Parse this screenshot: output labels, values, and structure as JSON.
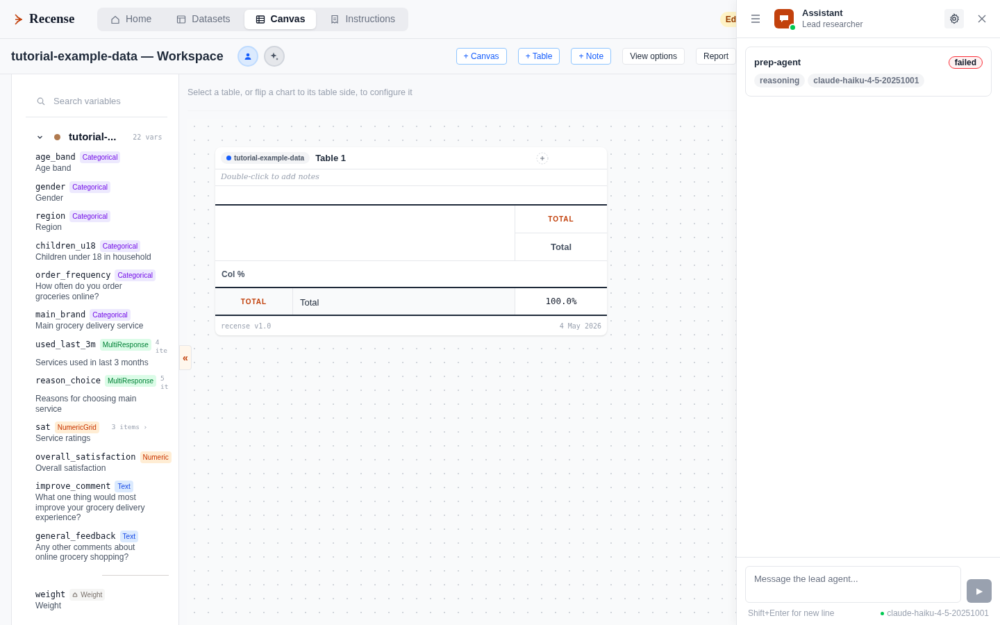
{
  "brand": "Recense",
  "nav_tabs": [
    {
      "label": "Home",
      "selected": false
    },
    {
      "label": "Datasets",
      "selected": false
    },
    {
      "label": "Canvas",
      "selected": true
    },
    {
      "label": "Instructions",
      "selected": false
    }
  ],
  "edit_badge": "Ed",
  "workspace_title": "tutorial-example-data — Workspace",
  "mode_buttons": [
    {
      "selected": true
    },
    {
      "selected": false
    }
  ],
  "toolbar": [
    {
      "label": "+ Canvas",
      "kind": "add"
    },
    {
      "label": "+ Table",
      "kind": "add"
    },
    {
      "label": "+ Note",
      "kind": "add"
    },
    {
      "label": "View options",
      "kind": "plain"
    },
    {
      "label": "Report",
      "kind": "plain"
    }
  ],
  "sidebar": {
    "search_placeholder": "Search variables",
    "dataset": {
      "name": "tutorial-...",
      "count": "22 vars",
      "expanded": true,
      "color": "#b07a4f"
    },
    "variables": [
      {
        "name": "age_band",
        "type": "Categorical",
        "kind": "categorical",
        "label": "Age band"
      },
      {
        "name": "gender",
        "type": "Categorical",
        "kind": "categorical",
        "label": "Gender"
      },
      {
        "name": "region",
        "type": "Categorical",
        "kind": "categorical",
        "label": "Region"
      },
      {
        "name": "children_u18",
        "type": "Categorical",
        "kind": "categorical",
        "label": "Children under 18 in household"
      },
      {
        "name": "order_frequency",
        "type": "Categorical",
        "kind": "categorical",
        "label": "How often do you order groceries online?"
      },
      {
        "name": "main_brand",
        "type": "Categorical",
        "kind": "categorical",
        "label": "Main grocery delivery service"
      },
      {
        "name": "used_last_3m",
        "type": "MultiResponse",
        "kind": "multi",
        "count": "4 ite",
        "label": "Services used in last 3 months"
      },
      {
        "name": "reason_choice",
        "type": "MultiResponse",
        "kind": "multi",
        "count": "5 it",
        "label": "Reasons for choosing main service"
      },
      {
        "name": "sat",
        "type": "NumericGrid",
        "kind": "numeric",
        "count": "3 items ›",
        "label": "Service ratings"
      },
      {
        "name": "overall_satisfaction",
        "type": "Numeric",
        "kind": "numeric",
        "label": "Overall satisfaction"
      },
      {
        "name": "improve_comment",
        "type": "Text",
        "kind": "text",
        "label": "What one thing would most improve your grocery delivery experience?"
      },
      {
        "name": "general_feedback",
        "type": "Text",
        "kind": "text",
        "label": "Any other comments about online grocery shopping?"
      }
    ],
    "weight": {
      "name": "weight",
      "type": "Weight",
      "kind": "weight",
      "label": "Weight"
    },
    "collapse": "«"
  },
  "config_hint": "Select a table, or flip a chart to its table side, to configure it",
  "table_card": {
    "dataset": "tutorial-example-data",
    "title": "Table 1",
    "notes_placeholder": "Double-click to add notes",
    "col_group": "TOTAL",
    "col_header": "Total",
    "stat": "Col %",
    "row_group": "TOTAL",
    "row_label": "Total",
    "value": "100.0%",
    "footer_left": "recense v1.0",
    "footer_right": "4 May 2026"
  },
  "assistant": {
    "title": "Assistant",
    "subtitle": "Lead researcher",
    "online": true,
    "agents": [
      {
        "name": "prep-agent",
        "status": "failed",
        "tags": [
          "reasoning",
          "claude-haiku-4-5-20251001"
        ]
      }
    ],
    "input_placeholder": "Message the lead agent...",
    "send": "▶",
    "hint": "Shift+Enter for new line",
    "model": "claude-haiku-4-5-20251001"
  }
}
